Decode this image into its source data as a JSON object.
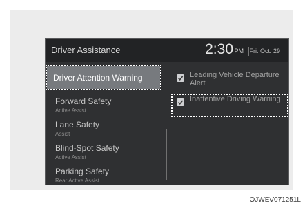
{
  "header": {
    "title": "Driver Assistance",
    "time": "2:30",
    "ampm": "PM",
    "date": "Fri. Oct. 29"
  },
  "menu": {
    "items": [
      {
        "label": "Driver Attention Warning",
        "sub": ""
      },
      {
        "label": "Forward Safety",
        "sub": "Active Assist"
      },
      {
        "label": "Lane Safety",
        "sub": "Assist"
      },
      {
        "label": "Blind-Spot Safety",
        "sub": "Active Assist"
      },
      {
        "label": "Parking Safety",
        "sub": "Rear Active Assist"
      }
    ]
  },
  "options": [
    {
      "label": "Leading Vehicle Departure Alert",
      "checked": true
    },
    {
      "label": "Inattentive Driving Warning",
      "checked": true
    }
  ],
  "caption": "OJWEV071251L",
  "colors": {
    "screen_bg": "#2f3032",
    "selected_bg": "#777a7e",
    "text_muted": "#8b8b8b"
  }
}
